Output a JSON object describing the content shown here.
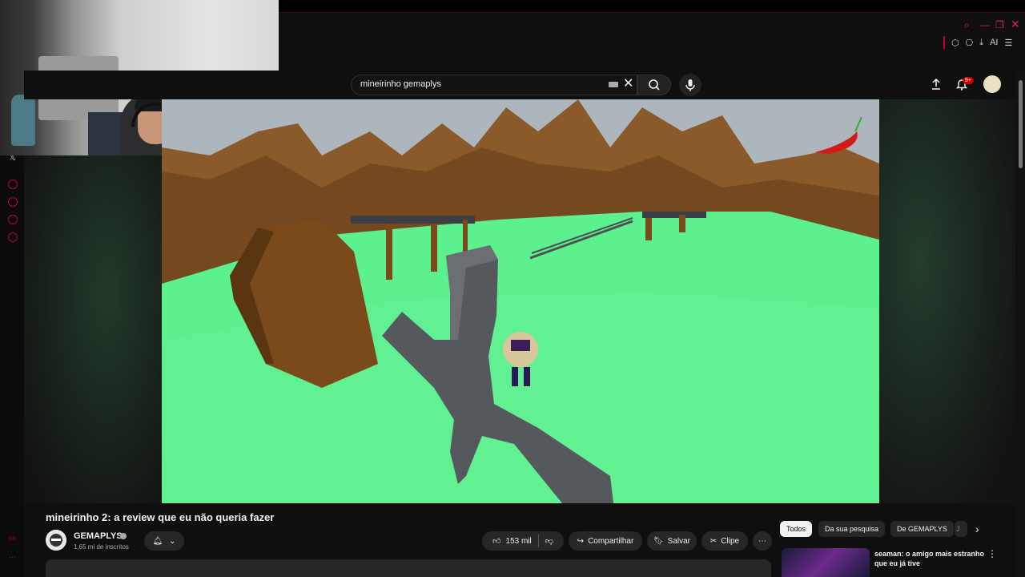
{
  "browser": {
    "window_controls": [
      "search",
      "minimize",
      "restore",
      "close"
    ],
    "toolbar_ai_label": "AI"
  },
  "search": {
    "query": "mineirinho gemaplys"
  },
  "header": {
    "notifications_badge": "9+"
  },
  "video": {
    "title": "mineirinho 2: a review que eu não queria fazer"
  },
  "channel": {
    "name": "GEMAPLYS",
    "subscribers": "1,65 mi de inscritos"
  },
  "actions": {
    "likes": "153 mil",
    "share": "Compartilhar",
    "save": "Salvar",
    "clip": "Clipe"
  },
  "chips": [
    "Todos",
    "Da sua pesquisa",
    "De GEMAPLYS",
    "J"
  ],
  "recommended": [
    {
      "title": "seaman: o amigo mais estranho que eu já tive"
    }
  ],
  "left_rail": {
    "label": "GX"
  },
  "colors": {
    "accent": "#c4002b",
    "grass": "#5cf08e",
    "sky": "#aeb6bd",
    "cliff": "#8a5a2b"
  }
}
